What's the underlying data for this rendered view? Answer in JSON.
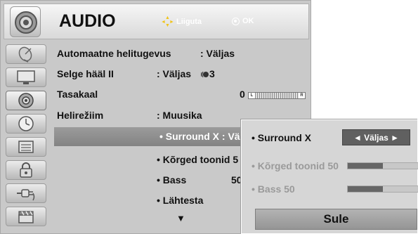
{
  "header": {
    "title": "AUDIO",
    "nav_hint": "Liiguta",
    "ok_hint": "OK",
    "icon": "speaker-icon"
  },
  "sidebar": {
    "items": [
      {
        "icon": "satellite-dish-icon"
      },
      {
        "icon": "monitor-icon"
      },
      {
        "icon": "speaker-icon",
        "active": true
      },
      {
        "icon": "clock-icon"
      },
      {
        "icon": "settings-panel-icon"
      },
      {
        "icon": "lock-icon"
      },
      {
        "icon": "input-plug-icon"
      },
      {
        "icon": "clapperboard-icon"
      }
    ]
  },
  "menu": {
    "rows": [
      {
        "label": "Automaatne helitugevus",
        "value": ": Väljas"
      },
      {
        "label": "Selge hääl II",
        "value": ": Väljas",
        "level": "3"
      },
      {
        "label": "Tasakaal",
        "value": "0",
        "balance_left": "L",
        "balance_right": "R"
      },
      {
        "label": "Helirežiim",
        "value": ": Muusika"
      }
    ],
    "highlight": "• Surround X : Vä",
    "sub_items": [
      "• Kõrged toonid 5",
      "• Bass",
      "• Lähtesta"
    ],
    "bass_value": "50",
    "more_arrow": "▼"
  },
  "popup": {
    "surround_label": "• Surround X",
    "surround_value": "◄ Väljas ►",
    "treble_label": "• Kõrged toonid 50",
    "treble_level": 0.5,
    "bass_label": "• Bass 50",
    "bass_level": 0.5,
    "close_label": "Sule"
  }
}
